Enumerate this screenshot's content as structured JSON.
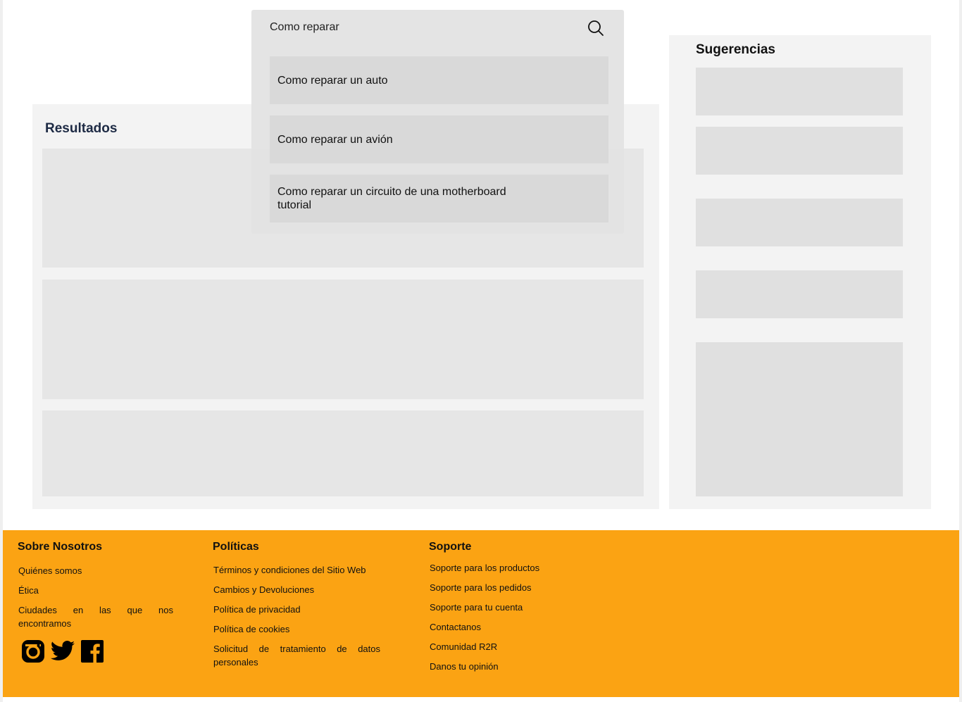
{
  "search": {
    "value": "Como reparar",
    "suggestions": [
      "Como reparar un auto",
      "Como reparar un avión",
      "Como reparar un circuito de una motherboard tutorial"
    ]
  },
  "results": {
    "title": "Resultados"
  },
  "sidebar": {
    "title": "Sugerencias"
  },
  "footer": {
    "about": {
      "heading": "Sobre Nosotros",
      "links": [
        "Quiénes somos",
        "Ética",
        "Ciudades en las que nos encontramos"
      ]
    },
    "policies": {
      "heading": "Políticas",
      "links": [
        "Términos y condiciones del Sitio Web",
        "Cambios y Devoluciones",
        "Política de privacidad",
        "Política de cookies",
        "Solicitud de tratamiento de datos personales"
      ]
    },
    "support": {
      "heading": "Soporte",
      "links": [
        "Soporte para los productos",
        "Soporte para los pedidos",
        "Soporte para tu cuenta",
        "Contactanos",
        "Comunidad R2R",
        "Danos tu opinión"
      ]
    },
    "social_icons": [
      "instagram-icon",
      "twitter-icon",
      "facebook-icon"
    ]
  },
  "colors": {
    "footer_bg": "#fba313",
    "panel_bg": "#f3f3f3",
    "card_bg": "#e6e6e6",
    "title_color": "#1d2a44"
  }
}
